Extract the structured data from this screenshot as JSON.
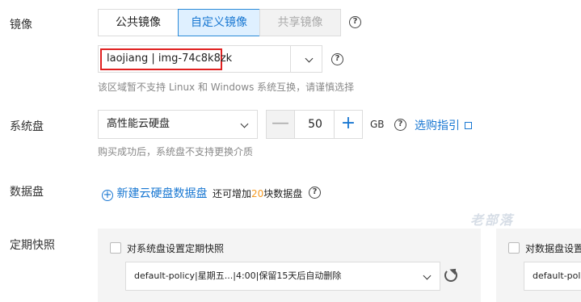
{
  "image": {
    "label": "镜像",
    "tabs": [
      "公共镜像",
      "自定义镜像",
      "共享镜像"
    ],
    "selected": "laojiang | img-74c8k8zk",
    "hint": "该区域暂不支持 Linux 和 Windows 系统互换，请谨慎选择"
  },
  "system_disk": {
    "label": "系统盘",
    "type": "高性能云硬盘",
    "size": "50",
    "unit": "GB",
    "minus": "—",
    "plus": "+",
    "guide_link": "选购指引",
    "hint": "购买成功后，系统盘不支持更换介质"
  },
  "data_disk": {
    "label": "数据盘",
    "add_link": "新建云硬盘数据盘",
    "note_prefix": "还可增加",
    "note_count": "20",
    "note_suffix": "块数据盘"
  },
  "snapshot": {
    "label": "定期快照",
    "system_checkbox": "对系统盘设置定期快照",
    "system_policy": "default-policy|星期五...|4:00|保留15天后自动删除",
    "data_checkbox": "对数据盘设置",
    "data_policy": "default-policy"
  },
  "watermark": "老部落",
  "help_glyph": "?",
  "colors": {
    "accent": "#1877d2",
    "highlight_border": "#e02020",
    "note_count": "#f59a23"
  }
}
